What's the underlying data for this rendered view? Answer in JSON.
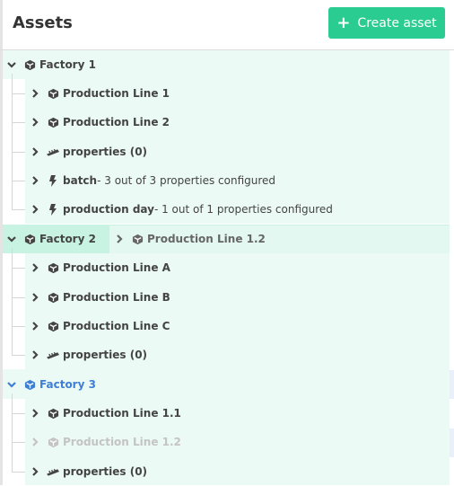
{
  "header": {
    "title": "Assets",
    "create_button_label": "Create asset",
    "create_button_color": "#2bcc91"
  },
  "tree": {
    "factory1": {
      "label": "Factory 1",
      "children": [
        {
          "label": "Production Line 1",
          "icon": "cube-icon"
        },
        {
          "label": "Production Line 2",
          "icon": "cube-icon"
        },
        {
          "label": "properties (0)",
          "icon": "ruler-icon"
        },
        {
          "label": "batch",
          "desc": " - 3 out of 3 properties configured",
          "icon": "bolt-icon"
        },
        {
          "label": "production day",
          "desc": " - 1 out of 1 properties configured",
          "icon": "bolt-icon"
        }
      ]
    },
    "factory2": {
      "label": "Factory 2",
      "drag_preview_label": "Production Line 1.2",
      "children": [
        {
          "label": "Production Line A",
          "icon": "cube-icon"
        },
        {
          "label": "Production Line B",
          "icon": "cube-icon"
        },
        {
          "label": "Production Line C",
          "icon": "cube-icon"
        },
        {
          "label": "properties (0)",
          "icon": "ruler-icon"
        }
      ]
    },
    "factory3": {
      "label": "Factory 3",
      "children": [
        {
          "label": "Production Line 1.1",
          "icon": "cube-icon"
        },
        {
          "label": "Production Line 1.2",
          "icon": "cube-icon",
          "state": "dragging-ghost"
        },
        {
          "label": "properties (0)",
          "icon": "ruler-icon"
        }
      ]
    }
  },
  "colors": {
    "accent": "#2bcc91",
    "tree_background": "#ebfaf5",
    "selected_row": "#c8f2e2",
    "active_link": "#3e7fd6"
  }
}
